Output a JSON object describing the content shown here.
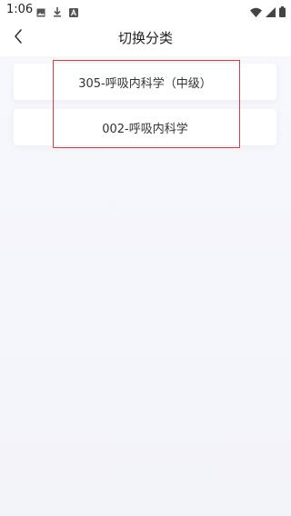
{
  "status_bar": {
    "time": "1:06",
    "icons": [
      "image-icon",
      "download-icon",
      "a-icon",
      "wifi-icon",
      "signal-icon",
      "battery-icon"
    ]
  },
  "header": {
    "title": "切换分类",
    "back_icon": "chevron-left-icon"
  },
  "categories": [
    {
      "label": "305-呼吸内科学（中级）"
    },
    {
      "label": "002-呼吸内科学"
    }
  ],
  "colors": {
    "highlight": "#e03a3a",
    "background": "#f5f6fa",
    "card": "#ffffff"
  }
}
